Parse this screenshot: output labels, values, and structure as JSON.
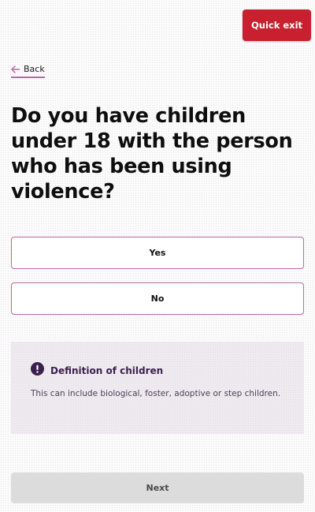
{
  "header": {
    "quick_exit_label": "Quick exit"
  },
  "nav": {
    "back_label": "Back"
  },
  "question": {
    "title": "Do you have children under 18 with the person who has been using violence?"
  },
  "options": [
    {
      "label": "Yes"
    },
    {
      "label": "No"
    }
  ],
  "definition": {
    "icon": "exclamation-icon",
    "title": "Definition of children",
    "body": "This can include biological, foster, adoptive or step children."
  },
  "footer": {
    "next_label": "Next"
  },
  "colors": {
    "quick_exit_bg": "#c8202e",
    "accent": "#b46aa6",
    "definition_icon": "#3b1f4d",
    "next_disabled_bg": "#dcdcdc"
  }
}
